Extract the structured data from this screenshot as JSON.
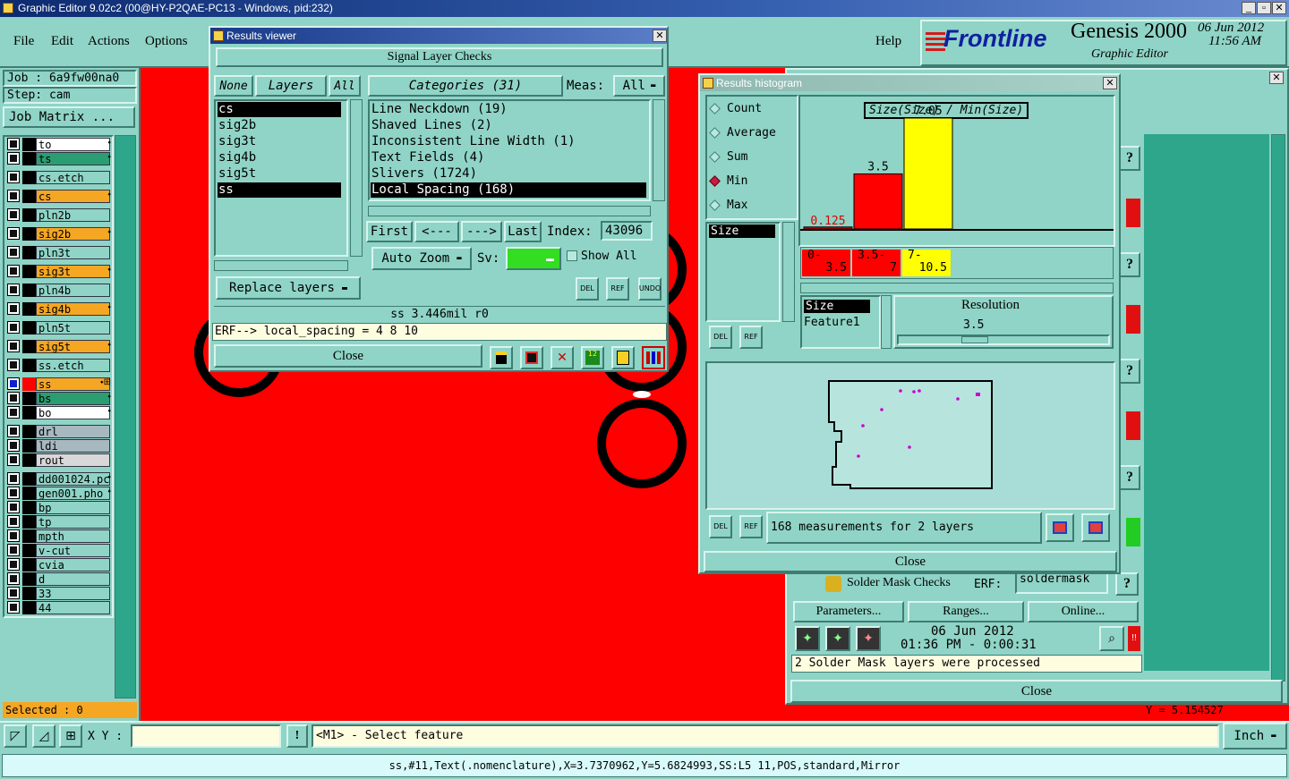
{
  "window_title": "Graphic Editor 9.02c2 (00@HY-P2QAE-PC13 - Windows, pid:232)",
  "menu": [
    "File",
    "Edit",
    "Actions",
    "Options",
    "Help"
  ],
  "brand": {
    "logo": "Frontline",
    "product": "Genesis 2000",
    "subtitle": "Graphic Editor",
    "date": "06 Jun 2012",
    "time": "11:56 AM"
  },
  "job": {
    "job_label": "Job  : 6a9fw00na0",
    "step_label": "Step: cam",
    "matrix_button": "Job Matrix ..."
  },
  "layers": [
    {
      "name": "to",
      "color": "#ffffff",
      "mark": "⬩"
    },
    {
      "name": "ts",
      "color": "#2a9e70",
      "mark": "⬩"
    },
    {
      "name": "cs.etch",
      "color": "#8fd4c6",
      "mark": ""
    },
    {
      "name": "cs",
      "color": "#f5a623",
      "mark": "⬩"
    },
    {
      "name": "pln2b",
      "color": "#8fd4c6",
      "mark": ""
    },
    {
      "name": "sig2b",
      "color": "#f5a623",
      "mark": "⬩"
    },
    {
      "name": "pln3t",
      "color": "#8fd4c6",
      "mark": ""
    },
    {
      "name": "sig3t",
      "color": "#f5a623",
      "mark": "⬩"
    },
    {
      "name": "pln4b",
      "color": "#8fd4c6",
      "mark": ""
    },
    {
      "name": "sig4b",
      "color": "#f5a623",
      "mark": "⬩"
    },
    {
      "name": "pln5t",
      "color": "#8fd4c6",
      "mark": ""
    },
    {
      "name": "sig5t",
      "color": "#f5a623",
      "mark": "⬩"
    },
    {
      "name": "ss.etch",
      "color": "#8fd4c6",
      "mark": ""
    },
    {
      "name": "ss",
      "color": "#f5a623",
      "mark": "⬩⊞"
    },
    {
      "name": "bs",
      "color": "#2a9e70",
      "mark": "⬩"
    },
    {
      "name": "bo",
      "color": "#ffffff",
      "mark": "⬩"
    },
    {
      "name": "drl",
      "color": "#a8b8c0",
      "mark": ""
    },
    {
      "name": "ldi",
      "color": "#a8b8c0",
      "mark": ""
    },
    {
      "name": "rout",
      "color": "#d8d8d8",
      "mark": ""
    },
    {
      "name": "dd001024.pc",
      "color": "#8fd4c6",
      "mark": "⬩"
    },
    {
      "name": "gen001.pho",
      "color": "#8fd4c6",
      "mark": "⬩"
    },
    {
      "name": "bp",
      "color": "#8fd4c6",
      "mark": ""
    },
    {
      "name": "tp",
      "color": "#8fd4c6",
      "mark": ""
    },
    {
      "name": "mpth",
      "color": "#8fd4c6",
      "mark": ""
    },
    {
      "name": "v-cut",
      "color": "#8fd4c6",
      "mark": ""
    },
    {
      "name": "cvia",
      "color": "#8fd4c6",
      "mark": ""
    },
    {
      "name": "d",
      "color": "#8fd4c6",
      "mark": ""
    },
    {
      "name": "33",
      "color": "#8fd4c6",
      "mark": ""
    },
    {
      "name": "44",
      "color": "#8fd4c6",
      "mark": ""
    }
  ],
  "selected_label": "Selected : 0",
  "results_viewer": {
    "title": "Results viewer",
    "header": "Signal Layer Checks",
    "none_btn": "None",
    "layers_btn": "Layers",
    "all_btn": "All",
    "layer_list": [
      "cs",
      "sig2b",
      "sig3t",
      "sig4b",
      "sig5t",
      "ss"
    ],
    "categories_btn": "Categories (31)",
    "meas_label": "Meas:",
    "meas_value": "All",
    "categories": [
      "Line Neckdown (19)",
      "Shaved Lines (2)",
      "Inconsistent Line Width (1)",
      "Text Fields (4)",
      "Slivers (1724)",
      "Local Spacing (168)"
    ],
    "first": "First",
    "prev": "<---",
    "next": "--->",
    "last": "Last",
    "index_label": "Index:",
    "index_value": "43096",
    "auto_zoom": "Auto Zoom",
    "sv_label": "Sv:",
    "show_all": "Show All",
    "replace_layers": "Replace layers",
    "del": "DEL",
    "ref": "REF",
    "undo": "UNDO",
    "status": "ss 3.446mil  r0",
    "erf": "ERF--> local_spacing = 4 8 10",
    "close": "Close"
  },
  "histogram": {
    "title": "Results histogram",
    "radios": [
      "Count",
      "Average",
      "Sum",
      "Min",
      "Max"
    ],
    "selected_radio": "Min",
    "attr_list": [
      "Size"
    ],
    "chart_title": "Size(Size) / Min(Size)",
    "bins": [
      "0-\n3.5",
      "3.5-\n7",
      "7-\n10.5"
    ],
    "bin_a": [
      "0-",
      "3.5-",
      "7-"
    ],
    "bin_b": [
      "3.5",
      "7",
      "10.5"
    ],
    "resolution_label": "Resolution",
    "resolution_value": "3.5",
    "attr2": [
      "Size",
      "Feature1"
    ],
    "summary": "168 measurements for 2 layers",
    "close": "Close"
  },
  "chart_data": {
    "type": "bar",
    "title": "Size(Size) / Min(Size)",
    "categories": [
      "0-3.5",
      "3.5-7",
      "7-10.5"
    ],
    "values": [
      0.125,
      3.5,
      7.05
    ],
    "colors": [
      "#ff0000",
      "#ff0000",
      "#ffff00"
    ],
    "ylim": [
      0,
      7.05
    ]
  },
  "solder": {
    "title": "Solder Mask Checks",
    "erf_label": "ERF:",
    "erf_value": "soldermask",
    "params": "Parameters...",
    "ranges": "Ranges...",
    "online": "Online...",
    "date": "06 Jun 2012",
    "time": "01:36 PM - 0:00:31",
    "message": "2 Solder Mask layers were processed",
    "close": "Close",
    "coord_hint": "Y = 5.154527"
  },
  "bottom": {
    "xy_label": "X Y :",
    "hint": "<M1> - Select feature",
    "units": "Inch",
    "status": "ss,#11,Text(.nomenclature),X=3.7370962,Y=5.6824993,SS:L5 11,POS,standard,Mirror"
  }
}
